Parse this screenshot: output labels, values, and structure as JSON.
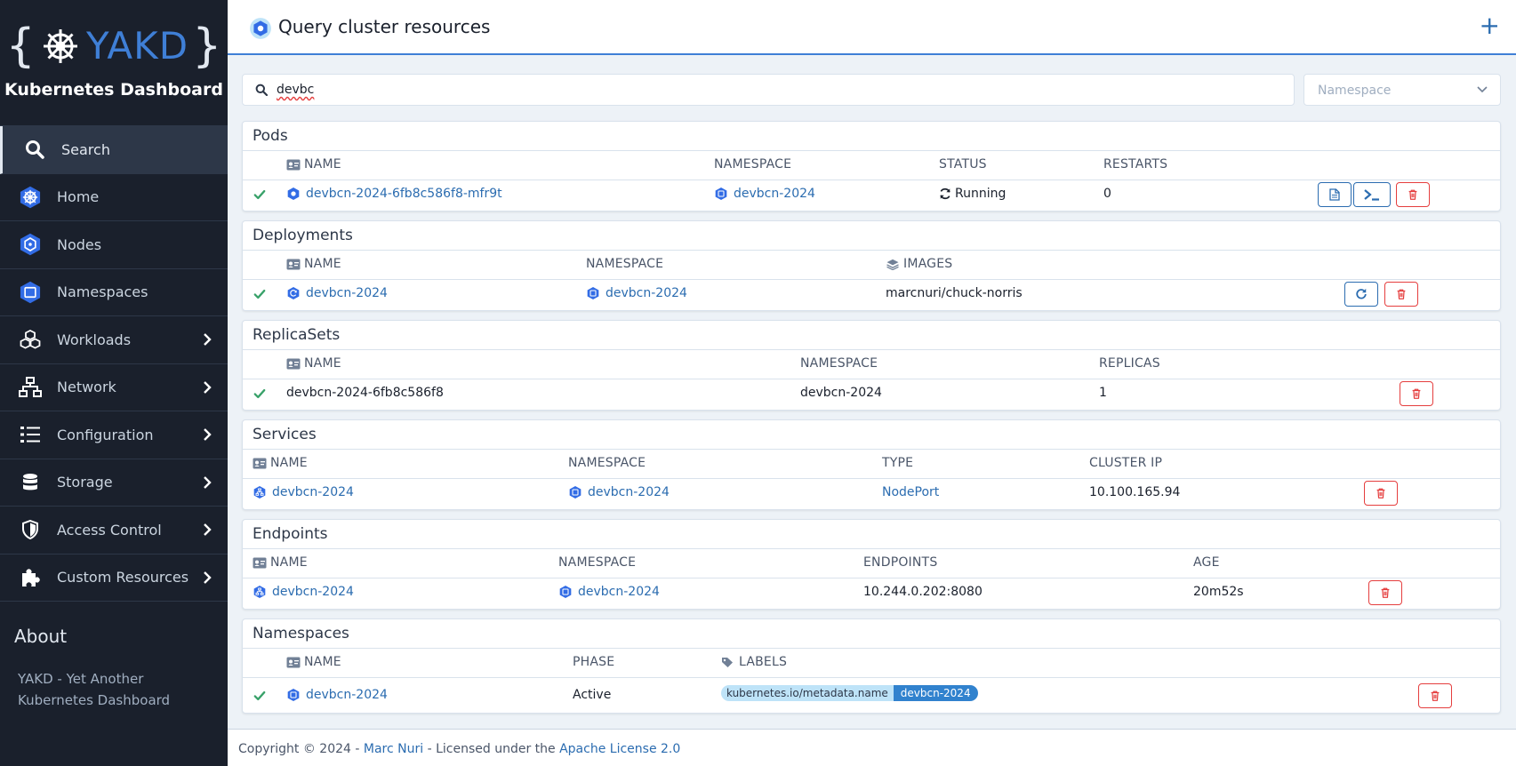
{
  "sidebar": {
    "logo_left": "{",
    "logo_name": "YAKD",
    "logo_right": "}",
    "subtitle": "Kubernetes Dashboard",
    "items": [
      {
        "label": "Search",
        "icon": "search-icon"
      },
      {
        "label": "Home",
        "icon": "kubernetes-icon"
      },
      {
        "label": "Nodes",
        "icon": "node-icon"
      },
      {
        "label": "Namespaces",
        "icon": "namespace-icon"
      },
      {
        "label": "Workloads",
        "icon": "cubes-icon"
      },
      {
        "label": "Network",
        "icon": "network-icon"
      },
      {
        "label": "Configuration",
        "icon": "list-icon"
      },
      {
        "label": "Storage",
        "icon": "database-icon"
      },
      {
        "label": "Access Control",
        "icon": "shield-icon"
      },
      {
        "label": "Custom Resources",
        "icon": "puzzle-icon"
      }
    ],
    "about_title": "About",
    "about_text": "YAKD - Yet Another Kubernetes Dashboard"
  },
  "header": {
    "title": "Query cluster resources",
    "add_label": "+"
  },
  "search": {
    "value": "devbc",
    "namespace_placeholder": "Namespace"
  },
  "pods": {
    "title": "Pods",
    "columns": [
      "NAME",
      "NAMESPACE",
      "STATUS",
      "RESTARTS"
    ],
    "row": {
      "name": "devbcn-2024-6fb8c586f8-mfr9t",
      "namespace": "devbcn-2024",
      "status": "Running",
      "restarts": "0"
    }
  },
  "deployments": {
    "title": "Deployments",
    "columns": [
      "NAME",
      "NAMESPACE",
      "IMAGES"
    ],
    "row": {
      "name": "devbcn-2024",
      "namespace": "devbcn-2024",
      "images": "marcnuri/chuck-norris"
    }
  },
  "replicasets": {
    "title": "ReplicaSets",
    "columns": [
      "NAME",
      "NAMESPACE",
      "REPLICAS"
    ],
    "row": {
      "name": "devbcn-2024-6fb8c586f8",
      "namespace": "devbcn-2024",
      "replicas": "1"
    }
  },
  "services": {
    "title": "Services",
    "columns": [
      "NAME",
      "NAMESPACE",
      "TYPE",
      "CLUSTER IP"
    ],
    "row": {
      "name": "devbcn-2024",
      "namespace": "devbcn-2024",
      "type": "NodePort",
      "cluster_ip": "10.100.165.94"
    }
  },
  "endpoints": {
    "title": "Endpoints",
    "columns": [
      "NAME",
      "NAMESPACE",
      "ENDPOINTS",
      "AGE"
    ],
    "row": {
      "name": "devbcn-2024",
      "namespace": "devbcn-2024",
      "endpoints": "10.244.0.202:8080",
      "age": "20m52s"
    }
  },
  "namespaces": {
    "title": "Namespaces",
    "columns": [
      "NAME",
      "PHASE",
      "LABELS"
    ],
    "row": {
      "name": "devbcn-2024",
      "phase": "Active",
      "label_key": "kubernetes.io/metadata.name",
      "label_value": "devbcn-2024"
    }
  },
  "footer": {
    "prefix": "Copyright © 2024 - ",
    "author": "Marc Nuri",
    "middle": " - Licensed under the ",
    "license": "Apache License 2.0"
  },
  "colors": {
    "sidebar_bg": "#1a202c",
    "accent": "#3f7fd6",
    "link": "#2b6cb0",
    "success": "#38a169",
    "danger": "#e53e3e"
  }
}
